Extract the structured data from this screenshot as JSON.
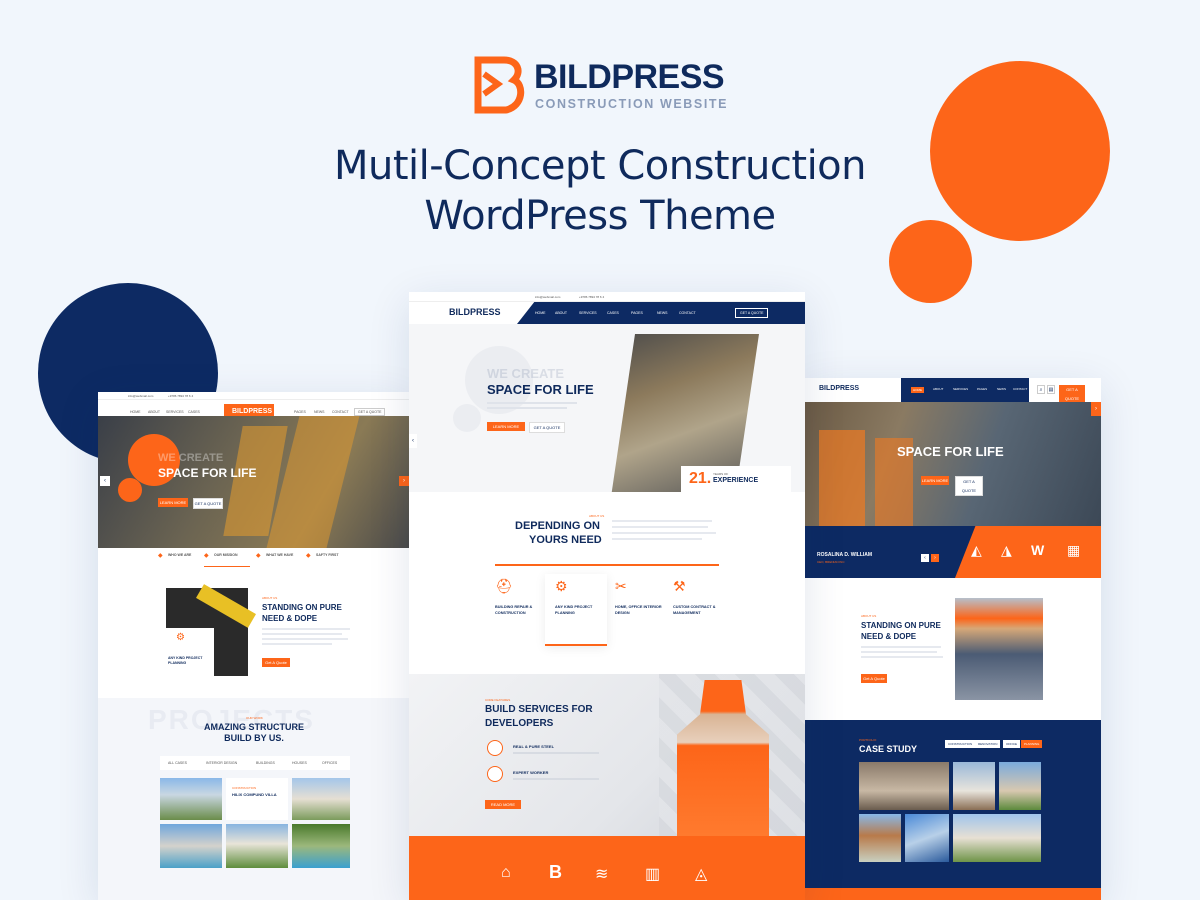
{
  "brand": {
    "name": "BILDPRESS",
    "tagline": "CONSTRUCTION WEBSITE",
    "headline_line1": "Mutil-Concept Construction",
    "headline_line2": "WordPress Theme"
  },
  "colors": {
    "accent": "#fd6519",
    "navy": "#0d2a63",
    "background": "#f1f6fc"
  },
  "left_mock": {
    "topbar_email": "info@webmail.com",
    "topbar_phone": "+9786 7894 78 6 4",
    "nav": [
      "HOME",
      "ABOUT",
      "SERVICES",
      "CASES",
      "PAGES",
      "NEWS",
      "CONTACT"
    ],
    "quote_button": "GET A QUOTE",
    "hero_ghost": "WE CREATE",
    "hero_title": "SPACE FOR LIFE",
    "hero_btn1": "LEARN MORE",
    "hero_btn2": "GET A QUOTE",
    "features": [
      "WHO WE ARE",
      "OUR MISSION",
      "WHAT WE HAVE",
      "SAFTY FIRST"
    ],
    "about_tag": "ABOUT US",
    "about_title1": "STANDING ON PURE",
    "about_title2": "NEED & DOPE",
    "about_card": "ANY KIND PROJECT PLANNING",
    "about_btn": "Get A Quote",
    "projects_ghost": "PROJECTS",
    "projects_tag": "OUR WORK",
    "projects_title1": "AMAZING STRUCTURE",
    "projects_title2": "BUILD BY US.",
    "filters": [
      "ALL CASES",
      "INTERIOR DESIGN",
      "BUILDINGS",
      "HOUSES",
      "OFFICES"
    ],
    "villa_tag": "CONSTRUCTION",
    "villa_title": "HILIX COMPUND VILLA"
  },
  "center_mock": {
    "topbar_email": "info@webmail.com",
    "topbar_phone": "+9786 7894 78 6 4",
    "nav": [
      "HOME",
      "ABOUT",
      "SERVICES",
      "CASES",
      "PAGES",
      "NEWS",
      "CONTACT"
    ],
    "quote_button": "GET A QUOTE",
    "hero_ghost": "WE CREATE",
    "hero_title": "SPACE FOR LIFE",
    "hero_btn1": "LEARN MORE",
    "hero_btn2": "GET A QUOTE",
    "experience_number": "21.",
    "experience_small": "YEARS OF",
    "experience_label": "EXPERIENCE",
    "about_tag": "ABOUT US",
    "about_title1": "DEPENDING ON",
    "about_title2": "YOURS NEED",
    "services": [
      "BUILDING REPAIR & CONSTRUCTION",
      "ANY KIND PROJECT PLANNING",
      "HOME, OFFICE INTERIOR DESIGN",
      "CUSTOM CONTRACT & MANAGEMENT"
    ],
    "build_tag": "CORE FEATURES",
    "build_title1": "BUILD SERVICES FOR",
    "build_title2": "DEVELOPERS",
    "build_items": [
      "REAL & PURE STEEL",
      "EXPERT WORKER"
    ],
    "build_btn": "READ MORE"
  },
  "right_mock": {
    "nav": [
      "HOME",
      "ABOUT",
      "SERVICES",
      "PAGES",
      "NEWS",
      "CONTACT"
    ],
    "quote_button": "GET A QUOTE",
    "hero_title": "SPACE FOR LIFE",
    "hero_btn1": "LEARN MORE",
    "hero_btn2": "GET A QUOTE",
    "testimonial_name": "ROSALINA D. WILLIAM",
    "testimonial_role": "CEO, BRENIAN INC",
    "about_tag": "ABOUT US",
    "about_title1": "STANDING ON PURE",
    "about_title2": "NEED & DOPE",
    "about_btn": "Get A Quote",
    "case_tag": "PORTFOLIO",
    "case_title": "CASE STUDY",
    "case_filters": [
      "CONSTRUCTION",
      "RENOVATION",
      "OFFICE",
      "PLANNING"
    ]
  }
}
